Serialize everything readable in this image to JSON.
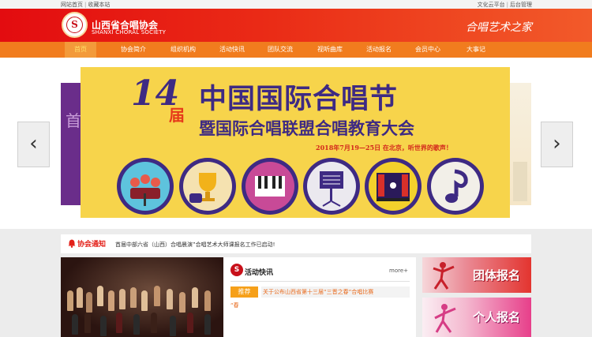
{
  "topbar": {
    "left_links": [
      "网站首页",
      "收藏本站"
    ],
    "right_links": [
      "文化云平台",
      "后台管理"
    ]
  },
  "header": {
    "logo_glyph": "S",
    "site_name": "山西省合唱协会",
    "site_name_en": "SHANXI CHORAL SOCIETY",
    "slogan": "合唱艺术之家"
  },
  "nav": {
    "items": [
      "首页",
      "协会简介",
      "组织机构",
      "活动快讯",
      "团队交流",
      "视听曲库",
      "活动报名",
      "会员中心",
      "大事记"
    ],
    "active_index": 0
  },
  "banner": {
    "number": "14",
    "jie": "届",
    "title_line1": "中国国际合唱节",
    "title_line2": "暨国际合唱联盟合唱教育大会",
    "date_line": "2018年7月19—25日 在北京，听世界的歌声！",
    "left_slide_glyph": "首",
    "prev_arrow": "‹",
    "next_arrow": "›",
    "icons": [
      "choir-icon",
      "trophy-icon",
      "piano-icon",
      "music-stand-icon",
      "stage-icon",
      "music-note-icon"
    ]
  },
  "notice": {
    "label": "协会通知",
    "text": "首届中部六省（山西）合唱晨演”合唱艺术大师课报名工作已启动!"
  },
  "news": {
    "logo_glyph": "S",
    "title": "活动快讯",
    "more": "more+",
    "tag": "推荐",
    "item_text": "关于公布山西省第十三届“三晋之春”合唱比赛",
    "item_cont": "“春"
  },
  "register": {
    "group_label": "团体报名",
    "person_label": "个人报名"
  },
  "colors": {
    "header_red": "#e30c10",
    "nav_orange": "#f17c1e",
    "banner_yellow": "#f7d44b",
    "banner_purple": "#3e2a83",
    "notice_red": "#e3211a"
  }
}
